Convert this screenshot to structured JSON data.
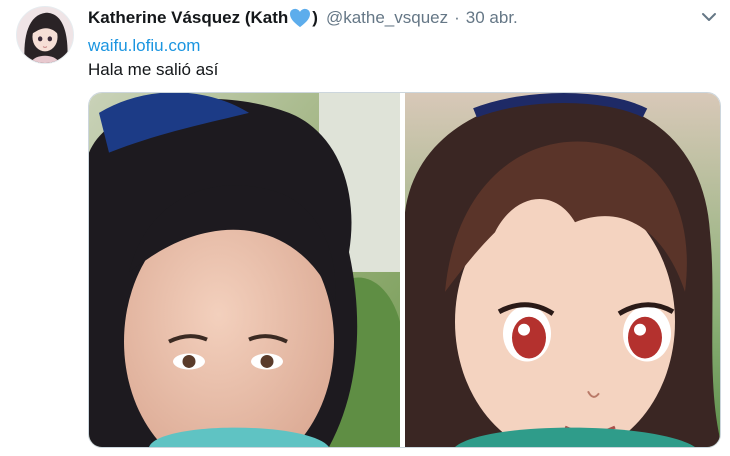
{
  "tweet": {
    "author_name": "Katherine Vásquez (Kath",
    "author_name_end": ")",
    "handle": "@kathe_vsquez",
    "separator": "·",
    "date": "30 abr.",
    "link_text": "waifu.lofiu.com",
    "body": "Hala me salió así",
    "heart_color": "#5dadec",
    "link_color": "#1b95e0"
  },
  "icons": {
    "avatar": "anime-girl-avatar",
    "heart": "blue-heart-icon",
    "menu": "chevron-down-icon"
  },
  "media": {
    "count": 2,
    "images": [
      "selfie-photo",
      "anime-waifu-portrait"
    ]
  }
}
